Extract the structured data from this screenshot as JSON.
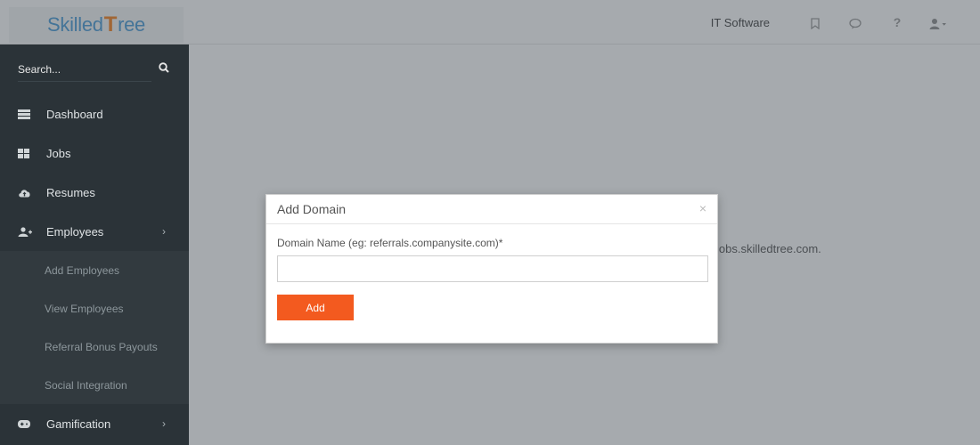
{
  "brand": {
    "logo_left": "Skilled",
    "logo_mark": "T",
    "logo_right": "ree"
  },
  "header": {
    "company": "IT Software",
    "icons": [
      "bookmark-icon",
      "chat-icon",
      "help-icon",
      "user-icon"
    ]
  },
  "sidebar": {
    "search_placeholder": "Search...",
    "items": [
      {
        "label": "Dashboard",
        "icon": "dashboard-icon"
      },
      {
        "label": "Jobs",
        "icon": "jobs-icon"
      },
      {
        "label": "Resumes",
        "icon": "cloud-upload-icon"
      },
      {
        "label": "Employees",
        "icon": "add-user-icon",
        "chevron": "›"
      },
      {
        "label": "Gamification",
        "icon": "gamepad-icon",
        "chevron": "›"
      }
    ],
    "sub_items": [
      {
        "label": "Add Employees"
      },
      {
        "label": "View Employees"
      },
      {
        "label": "Referral Bonus Payouts"
      },
      {
        "label": "Social Integration"
      }
    ]
  },
  "main": {
    "background_text": "jobs.skilledtree.com."
  },
  "modal": {
    "title": "Add Domain",
    "close": "×",
    "field_label": "Domain Name (eg: referrals.companysite.com)*",
    "field_value": "",
    "button_label": "Add"
  },
  "colors": {
    "accent": "#f35a1f",
    "sidebar_bg": "#2b3338",
    "brand_blue": "#4a9bd6",
    "brand_orange": "#f58220"
  }
}
